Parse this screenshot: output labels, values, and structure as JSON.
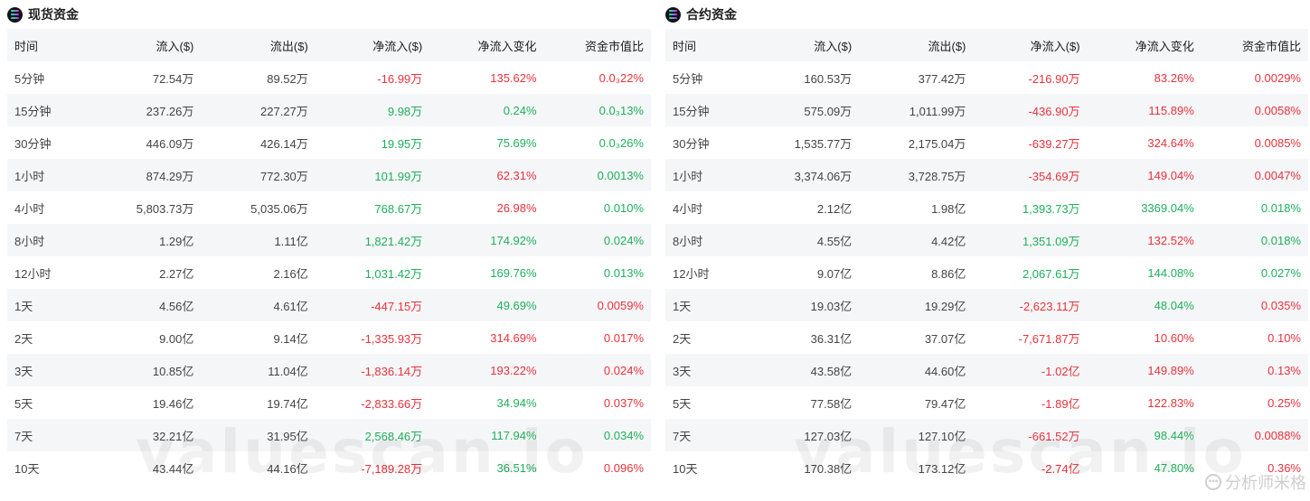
{
  "spot": {
    "title": "现货资金",
    "columns": [
      "时间",
      "流入($)",
      "流出($)",
      "净流入($)",
      "净流入变化",
      "资金市值比"
    ],
    "rows": [
      {
        "time": "5分钟",
        "inflow": "72.54万",
        "outflow": "89.52万",
        "net": "-16.99万",
        "net_dir": "neg",
        "change": "135.62%",
        "change_dir": "neg",
        "ratio": "0.0₃22%",
        "ratio_dir": "neg"
      },
      {
        "time": "15分钟",
        "inflow": "237.26万",
        "outflow": "227.27万",
        "net": "9.98万",
        "net_dir": "pos",
        "change": "0.24%",
        "change_dir": "pos",
        "ratio": "0.0₃13%",
        "ratio_dir": "pos"
      },
      {
        "time": "30分钟",
        "inflow": "446.09万",
        "outflow": "426.14万",
        "net": "19.95万",
        "net_dir": "pos",
        "change": "75.69%",
        "change_dir": "pos",
        "ratio": "0.0₃26%",
        "ratio_dir": "pos"
      },
      {
        "time": "1小时",
        "inflow": "874.29万",
        "outflow": "772.30万",
        "net": "101.99万",
        "net_dir": "pos",
        "change": "62.31%",
        "change_dir": "neg",
        "ratio": "0.0013%",
        "ratio_dir": "pos"
      },
      {
        "time": "4小时",
        "inflow": "5,803.73万",
        "outflow": "5,035.06万",
        "net": "768.67万",
        "net_dir": "pos",
        "change": "26.98%",
        "change_dir": "neg",
        "ratio": "0.010%",
        "ratio_dir": "pos"
      },
      {
        "time": "8小时",
        "inflow": "1.29亿",
        "outflow": "1.11亿",
        "net": "1,821.42万",
        "net_dir": "pos",
        "change": "174.92%",
        "change_dir": "pos",
        "ratio": "0.024%",
        "ratio_dir": "pos"
      },
      {
        "time": "12小时",
        "inflow": "2.27亿",
        "outflow": "2.16亿",
        "net": "1,031.42万",
        "net_dir": "pos",
        "change": "169.76%",
        "change_dir": "pos",
        "ratio": "0.013%",
        "ratio_dir": "pos"
      },
      {
        "time": "1天",
        "inflow": "4.56亿",
        "outflow": "4.61亿",
        "net": "-447.15万",
        "net_dir": "neg",
        "change": "49.69%",
        "change_dir": "pos",
        "ratio": "0.0059%",
        "ratio_dir": "neg"
      },
      {
        "time": "2天",
        "inflow": "9.00亿",
        "outflow": "9.14亿",
        "net": "-1,335.93万",
        "net_dir": "neg",
        "change": "314.69%",
        "change_dir": "neg",
        "ratio": "0.017%",
        "ratio_dir": "neg"
      },
      {
        "time": "3天",
        "inflow": "10.85亿",
        "outflow": "11.04亿",
        "net": "-1,836.14万",
        "net_dir": "neg",
        "change": "193.22%",
        "change_dir": "neg",
        "ratio": "0.024%",
        "ratio_dir": "neg"
      },
      {
        "time": "5天",
        "inflow": "19.46亿",
        "outflow": "19.74亿",
        "net": "-2,833.66万",
        "net_dir": "neg",
        "change": "34.94%",
        "change_dir": "pos",
        "ratio": "0.037%",
        "ratio_dir": "neg"
      },
      {
        "time": "7天",
        "inflow": "32.21亿",
        "outflow": "31.95亿",
        "net": "2,568.46万",
        "net_dir": "pos",
        "change": "117.94%",
        "change_dir": "pos",
        "ratio": "0.034%",
        "ratio_dir": "pos"
      },
      {
        "time": "10天",
        "inflow": "43.44亿",
        "outflow": "44.16亿",
        "net": "-7,189.28万",
        "net_dir": "neg",
        "change": "36.51%",
        "change_dir": "pos",
        "ratio": "0.096%",
        "ratio_dir": "neg"
      }
    ]
  },
  "futures": {
    "title": "合约资金",
    "columns": [
      "时间",
      "流入($)",
      "流出($)",
      "净流入($)",
      "净流入变化",
      "资金市值比"
    ],
    "rows": [
      {
        "time": "5分钟",
        "inflow": "160.53万",
        "outflow": "377.42万",
        "net": "-216.90万",
        "net_dir": "neg",
        "change": "83.26%",
        "change_dir": "neg",
        "ratio": "0.0029%",
        "ratio_dir": "neg"
      },
      {
        "time": "15分钟",
        "inflow": "575.09万",
        "outflow": "1,011.99万",
        "net": "-436.90万",
        "net_dir": "neg",
        "change": "115.89%",
        "change_dir": "neg",
        "ratio": "0.0058%",
        "ratio_dir": "neg"
      },
      {
        "time": "30分钟",
        "inflow": "1,535.77万",
        "outflow": "2,175.04万",
        "net": "-639.27万",
        "net_dir": "neg",
        "change": "324.64%",
        "change_dir": "neg",
        "ratio": "0.0085%",
        "ratio_dir": "neg"
      },
      {
        "time": "1小时",
        "inflow": "3,374.06万",
        "outflow": "3,728.75万",
        "net": "-354.69万",
        "net_dir": "neg",
        "change": "149.04%",
        "change_dir": "neg",
        "ratio": "0.0047%",
        "ratio_dir": "neg"
      },
      {
        "time": "4小时",
        "inflow": "2.12亿",
        "outflow": "1.98亿",
        "net": "1,393.73万",
        "net_dir": "pos",
        "change": "3369.04%",
        "change_dir": "pos",
        "ratio": "0.018%",
        "ratio_dir": "pos"
      },
      {
        "time": "8小时",
        "inflow": "4.55亿",
        "outflow": "4.42亿",
        "net": "1,351.09万",
        "net_dir": "pos",
        "change": "132.52%",
        "change_dir": "neg",
        "ratio": "0.018%",
        "ratio_dir": "pos"
      },
      {
        "time": "12小时",
        "inflow": "9.07亿",
        "outflow": "8.86亿",
        "net": "2,067.61万",
        "net_dir": "pos",
        "change": "144.08%",
        "change_dir": "pos",
        "ratio": "0.027%",
        "ratio_dir": "pos"
      },
      {
        "time": "1天",
        "inflow": "19.03亿",
        "outflow": "19.29亿",
        "net": "-2,623.11万",
        "net_dir": "neg",
        "change": "48.04%",
        "change_dir": "pos",
        "ratio": "0.035%",
        "ratio_dir": "neg"
      },
      {
        "time": "2天",
        "inflow": "36.31亿",
        "outflow": "37.07亿",
        "net": "-7,671.87万",
        "net_dir": "neg",
        "change": "10.60%",
        "change_dir": "neg",
        "ratio": "0.10%",
        "ratio_dir": "neg"
      },
      {
        "time": "3天",
        "inflow": "43.58亿",
        "outflow": "44.60亿",
        "net": "-1.02亿",
        "net_dir": "neg",
        "change": "149.89%",
        "change_dir": "neg",
        "ratio": "0.13%",
        "ratio_dir": "neg"
      },
      {
        "time": "5天",
        "inflow": "77.58亿",
        "outflow": "79.47亿",
        "net": "-1.89亿",
        "net_dir": "neg",
        "change": "122.83%",
        "change_dir": "neg",
        "ratio": "0.25%",
        "ratio_dir": "neg"
      },
      {
        "time": "7天",
        "inflow": "127.03亿",
        "outflow": "127.10亿",
        "net": "-661.52万",
        "net_dir": "neg",
        "change": "98.44%",
        "change_dir": "pos",
        "ratio": "0.0088%",
        "ratio_dir": "neg"
      },
      {
        "time": "10天",
        "inflow": "170.38亿",
        "outflow": "173.12亿",
        "net": "-2.74亿",
        "net_dir": "neg",
        "change": "47.80%",
        "change_dir": "pos",
        "ratio": "0.36%",
        "ratio_dir": "neg"
      }
    ]
  },
  "watermark": "valuescan.io",
  "corner_tag": "分析师米格",
  "colors": {
    "positive": "#1eb05a",
    "negative": "#e8323c",
    "stripe": "#f5f6f8"
  },
  "icons": {
    "panel_logo": "solana-logo-icon",
    "corner": "chat-bubble-icon"
  }
}
